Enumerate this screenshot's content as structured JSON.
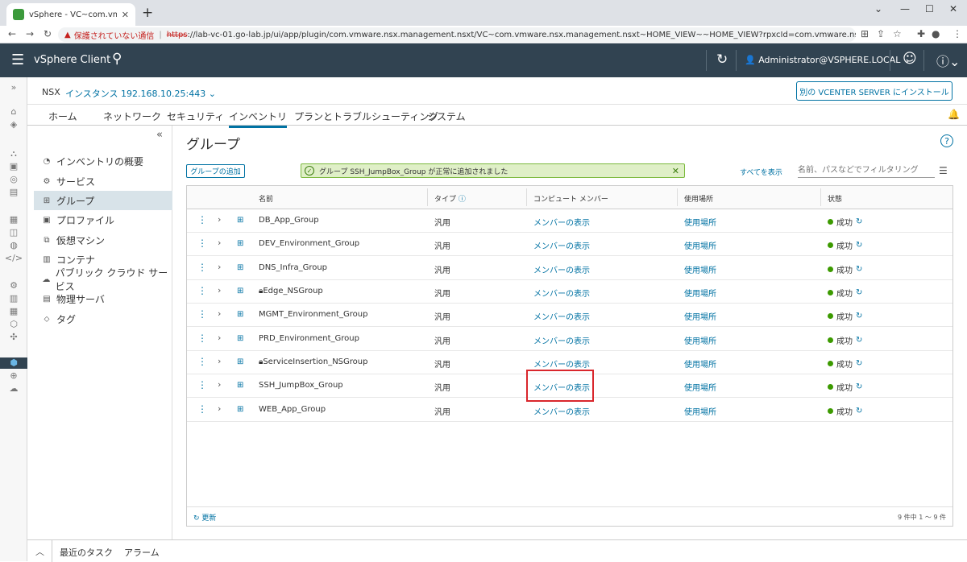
{
  "browser": {
    "tab_title": "vSphere - VC~com.vmware.nsx.m",
    "new_tab": "+",
    "warning_text": "保護されていない通信",
    "url_scheme": "https",
    "url_rest": "://lab-vc-01.go-lab.jp/ui/app/plugin/com.vmware.nsx.management.nsxt/VC~com.vmware.nsx.management.nsxt~HOME_VIEW~~HOME_VIEW?rpxcId=com.vmware.nsx.management.nsxt:3.2.0.1:-5535..."
  },
  "header": {
    "brand": "vSphere Client",
    "user": "Administrator@VSPHERE.LOCAL"
  },
  "nsx": {
    "label": "NSX",
    "instance": "インスタンス 192.168.10.25:443",
    "install_button": "別の VCENTER SERVER にインストール"
  },
  "main_tabs": [
    "ホーム",
    "ネットワーク",
    "セキュリティ",
    "インベントリ",
    "プランとトラブルシューティング",
    "システム"
  ],
  "active_tab": "インベントリ",
  "left_nav": [
    {
      "label": "インベントリの概要",
      "icon": "dashboard-icon"
    },
    {
      "label": "サービス",
      "icon": "gear-icon"
    },
    {
      "label": "グループ",
      "icon": "group-icon"
    },
    {
      "label": "プロファイル",
      "icon": "profile-icon"
    },
    {
      "label": "仮想マシン",
      "icon": "vm-icon"
    },
    {
      "label": "コンテナ",
      "icon": "container-icon"
    },
    {
      "label": "パブリック クラウド サービス",
      "icon": "cloud-icon"
    },
    {
      "label": "物理サーバ",
      "icon": "server-icon"
    },
    {
      "label": "タグ",
      "icon": "tag-icon"
    }
  ],
  "page": {
    "title": "グループ",
    "add_group": "グループの追加",
    "alert": "グループ SSH_JumpBox_Group が正常に追加されました",
    "show_all": "すべてを表示",
    "filter_placeholder": "名前、パスなどでフィルタリング"
  },
  "table": {
    "headers": {
      "name": "名前",
      "type": "タイプ",
      "members": "コンピュート メンバー",
      "usage": "使用場所",
      "status": "状態"
    },
    "rows": [
      {
        "name": "DB_App_Group",
        "locked": false,
        "type": "汎用",
        "members": "メンバーの表示",
        "usage": "使用場所",
        "status": "成功"
      },
      {
        "name": "DEV_Environment_Group",
        "locked": false,
        "type": "汎用",
        "members": "メンバーの表示",
        "usage": "使用場所",
        "status": "成功"
      },
      {
        "name": "DNS_Infra_Group",
        "locked": false,
        "type": "汎用",
        "members": "メンバーの表示",
        "usage": "使用場所",
        "status": "成功"
      },
      {
        "name": "Edge_NSGroup",
        "locked": true,
        "type": "汎用",
        "members": "メンバーの表示",
        "usage": "使用場所",
        "status": "成功"
      },
      {
        "name": "MGMT_Environment_Group",
        "locked": false,
        "type": "汎用",
        "members": "メンバーの表示",
        "usage": "使用場所",
        "status": "成功"
      },
      {
        "name": "PRD_Environment_Group",
        "locked": false,
        "type": "汎用",
        "members": "メンバーの表示",
        "usage": "使用場所",
        "status": "成功"
      },
      {
        "name": "ServiceInsertion_NSGroup",
        "locked": true,
        "type": "汎用",
        "members": "メンバーの表示",
        "usage": "使用場所",
        "status": "成功"
      },
      {
        "name": "SSH_JumpBox_Group",
        "locked": false,
        "type": "汎用",
        "members": "メンバーの表示",
        "usage": "使用場所",
        "status": "成功"
      },
      {
        "name": "WEB_App_Group",
        "locked": false,
        "type": "汎用",
        "members": "メンバーの表示",
        "usage": "使用場所",
        "status": "成功"
      }
    ],
    "refresh": "更新",
    "count": "9 件中 1 ～ 9 件"
  },
  "bottom": {
    "recent_tasks": "最近のタスク",
    "alarms": "アラーム"
  },
  "colors": {
    "header_bg": "#314351",
    "link": "#0072a3",
    "success_dot": "#3c9a00",
    "alert_bg": "#dfefc7",
    "highlight": "#d9262c"
  }
}
